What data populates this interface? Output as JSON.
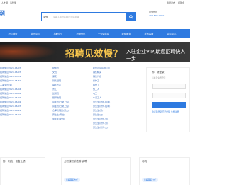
{
  "topbar": {
    "left": "人才网 | 请登录",
    "right": [
      "我要发布",
      "招聘会"
    ]
  },
  "header": {
    "logo": "网",
    "search_category": "职位",
    "search_placeholder": "请输入职位名称/公司名称等",
    "hotline_label": "服务热线",
    "hotline_number": "400-800-0000"
  },
  "nav": [
    "职位搜索",
    "简历中心",
    "招聘企业",
    "职场资讯",
    "一句话信息",
    "收费服务",
    "联系客服",
    "会员中心"
  ],
  "banner": {
    "text_big": "招聘见效慢？",
    "text_small": "入驻企业VIP,助您招聘快人一步"
  },
  "col1": [
    "招聘信息2023-06-07",
    "招聘信息2023-06-07",
    "招聘信息2023-05-31",
    "招聘信息2023-05-31",
    "人事专员(女)",
    "招聘信息2023-06-04",
    "招聘信息2023-06-04",
    "招聘信息2023-06-02",
    "招聘信息2023-06-02",
    "招聘信息2023-06-07",
    "招聘信息2023-06-14",
    "招聘信息2023-06-01"
  ],
  "col2": [
    "财务员",
    "文员",
    "保安",
    "销售经理",
    "销售代表",
    "普工",
    "送货员",
    "厨师助理",
    "营业员(日常上班)",
    "营业员(日常上班)",
    "仓库管理员(男女)",
    "男生生(男性)",
    "男生生(女性)"
  ],
  "col3": [
    "新华百货有限公司",
    "销售精英",
    "销售代表",
    "操作工",
    "操作工",
    "施工人",
    "电工",
    "车间工人",
    "男生生(计时,招聘)",
    "男生生(计件,招聘)",
    "男生生(男)",
    "男生生(女)",
    "男生生(计件,男)",
    "男生生(计件,男)",
    "男生生(计件,女)"
  ],
  "login": {
    "title": "你，请登录!",
    "hint": "手机号免费登录",
    "links": "验证码登录  忘记密码  免费注册"
  },
  "cards": [
    {
      "title": "厨、制航、设备业绩",
      "sub": "",
      "badge": "",
      "tag": ""
    },
    {
      "title": "全职兼职销售等 诚聘",
      "sub": "",
      "badge": "",
      "tag": "查看联系方式"
    },
    {
      "title": "司机",
      "sub": "",
      "badge": "",
      "tag": "查看联系方式"
    }
  ]
}
